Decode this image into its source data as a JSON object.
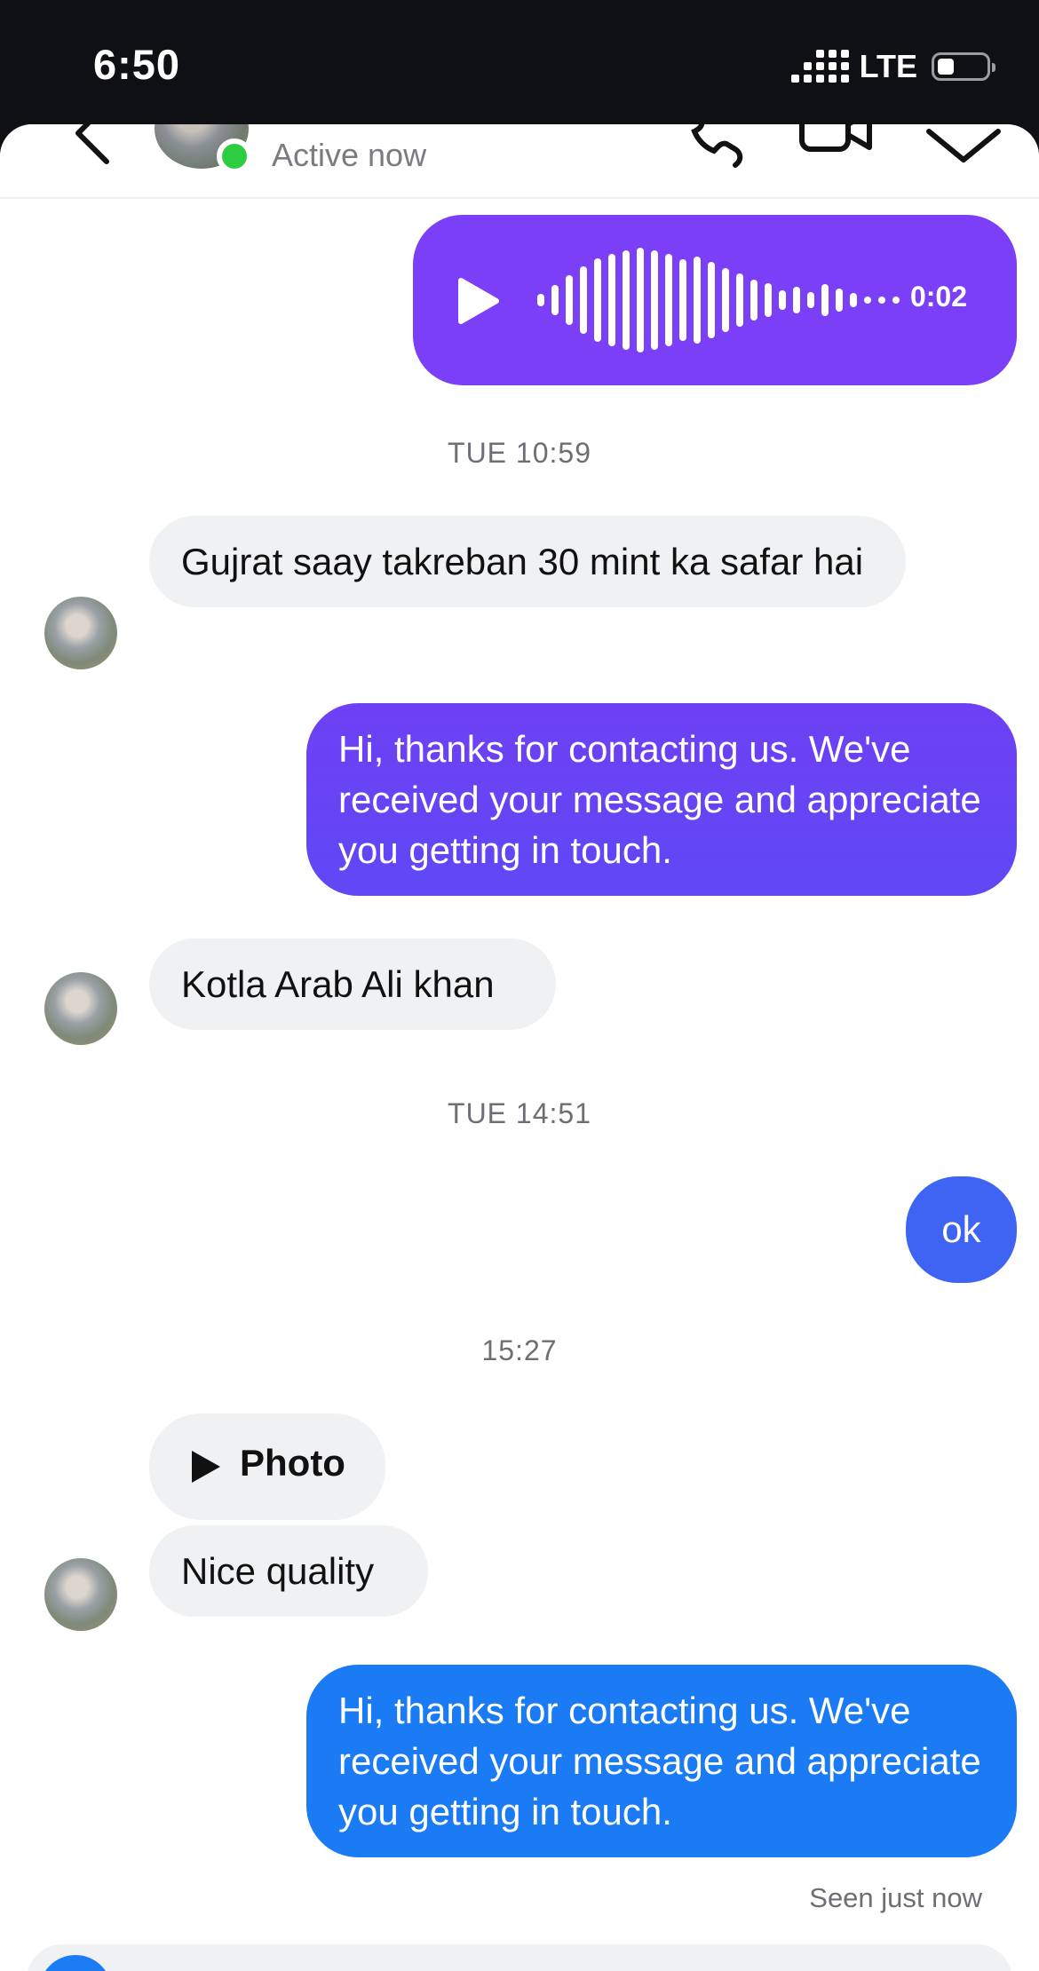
{
  "status_bar": {
    "time": "6:50",
    "network": "LTE"
  },
  "header": {
    "status": "Active now",
    "icons": [
      "back-chevron-icon",
      "phone-icon",
      "video-camera-icon",
      "info-icon"
    ]
  },
  "colors": {
    "audio_bubble": "#7b3ff7",
    "purple_bubble": "#6e40f4",
    "indigo_bubble": "#3f64f3",
    "blue_bubble": "#1b7bf4",
    "incoming_bubble": "#f0f1f3",
    "online": "#2ecc40"
  },
  "messages": {
    "audio_duration": "0:02",
    "ts1": "TUE 10:59",
    "in1": "Gujrat saay takreban 30 mint ka safar hai",
    "out1": "Hi, thanks for contacting us. We've received your message and appreciate you getting in touch.",
    "in2": "Kotla Arab Ali khan",
    "ts2": "TUE 14:51",
    "out2": "ok",
    "ts3": "15:27",
    "photo_label": "Photo",
    "in3": "Nice quality",
    "out3": "Hi, thanks for contacting us. We've received your message and appreciate you getting in touch.",
    "seen": "Seen just now"
  }
}
